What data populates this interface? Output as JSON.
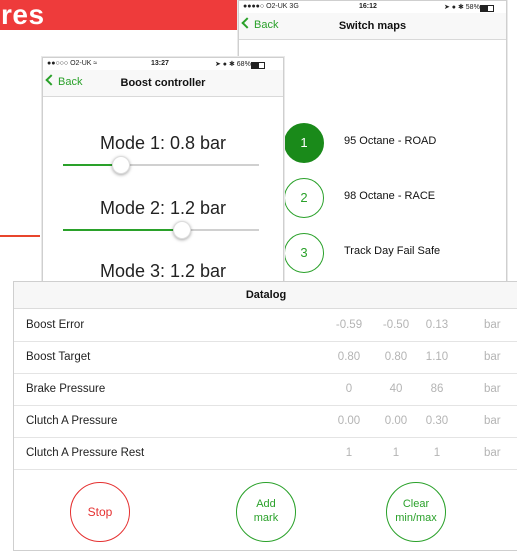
{
  "banner": {
    "text": "res"
  },
  "switch_phone": {
    "status": {
      "carrier": "●●●●○ O2-UK  3G",
      "time": "16:12",
      "right": "➤ ● ✱ 58%"
    },
    "nav": {
      "back": "Back",
      "title": "Switch maps"
    },
    "maps": [
      {
        "number": "1",
        "label": "95 Octane - ROAD",
        "active": true
      },
      {
        "number": "2",
        "label": "98 Octane - RACE",
        "active": false
      },
      {
        "number": "3",
        "label": "Track Day Fail Safe",
        "active": false
      }
    ]
  },
  "boost_phone": {
    "status": {
      "carrier": "●●○○○ O2-UK ≈",
      "time": "13:27",
      "right": "➤ ● ✱ 68%"
    },
    "nav": {
      "back": "Back",
      "title": "Boost controller"
    },
    "modes": [
      {
        "label": "Mode 1: 0.8 bar",
        "level": 0.29
      },
      {
        "label": "Mode 2: 1.2 bar",
        "level": 0.6
      },
      {
        "label": "Mode 3: 1.2 bar"
      }
    ]
  },
  "datalog": {
    "title": "Datalog",
    "rows": [
      {
        "name": "Boost Error",
        "values": [
          "-0.59",
          "-0.50",
          "0.13"
        ],
        "unit": "bar"
      },
      {
        "name": "Boost Target",
        "values": [
          "0.80",
          "0.80",
          "1.10"
        ],
        "unit": "bar"
      },
      {
        "name": "Brake Pressure",
        "values": [
          "0",
          "40",
          "86"
        ],
        "unit": "bar"
      },
      {
        "name": "Clutch A Pressure",
        "values": [
          "0.00",
          "0.00",
          "0.30"
        ],
        "unit": "bar"
      },
      {
        "name": "Clutch A Pressure Rest",
        "values": [
          "1",
          "1",
          "1"
        ],
        "unit": "bar"
      }
    ],
    "buttons": {
      "stop": "Stop",
      "add_line1": "Add",
      "add_line2": "mark",
      "clear_line1": "Clear",
      "clear_line2": "min/max"
    }
  },
  "colors": {
    "accent_green": "#2aa12a",
    "active_green": "#1a8a1a",
    "stop_red": "#e53030",
    "banner_red": "#ee3b3b"
  }
}
